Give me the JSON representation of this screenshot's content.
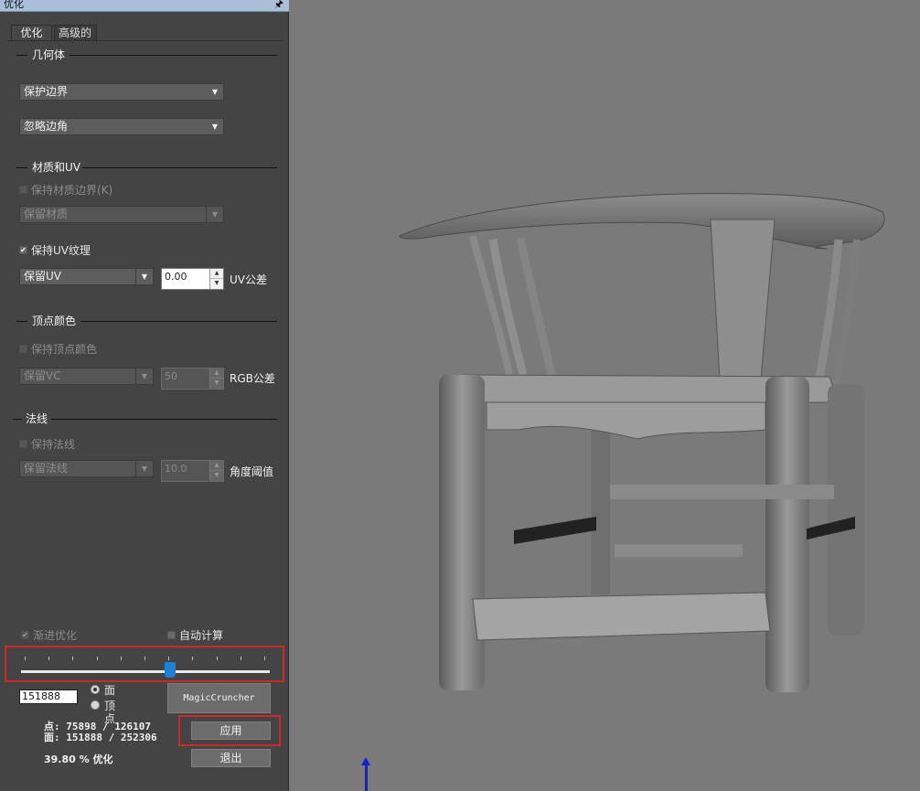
{
  "window": {
    "title": "优化",
    "pin_icon": "pin-icon"
  },
  "tabs": [
    {
      "label": "优化",
      "active": true
    },
    {
      "label": "高级的",
      "active": false
    }
  ],
  "geometry": {
    "section_label": "几何体",
    "boundary_combo": "保护边界",
    "corner_combo": "忽略边角"
  },
  "material": {
    "section_label": "材质和UV",
    "keep_material_boundary": {
      "label": "保持材质边界(K)",
      "checked": false,
      "enabled": false
    },
    "material_combo": "保留材质",
    "keep_uv_texture": {
      "label": "保持UV纹理",
      "checked": true,
      "enabled": true
    },
    "uv_combo": "保留UV",
    "uv_tolerance_value": "0.00",
    "uv_tolerance_label": "UV公差"
  },
  "vertex_color": {
    "section_label": "顶点颜色",
    "keep_vertex_color": {
      "label": "保持顶点颜色",
      "checked": false,
      "enabled": false
    },
    "vc_combo": "保留VC",
    "rgb_tolerance_value": "50",
    "rgb_tolerance_label": "RGB公差"
  },
  "normals": {
    "section_label": "法线",
    "keep_normals": {
      "label": "保持法线",
      "checked": false,
      "enabled": false
    },
    "normal_combo": "保留法线",
    "angle_value": "10.0",
    "angle_label": "角度阈值"
  },
  "bottom": {
    "progressive": {
      "label": "渐进优化",
      "checked": true,
      "enabled": false
    },
    "auto_compute": {
      "label": "自动计算",
      "checked": false
    },
    "slider_fraction": 0.6,
    "count_value": "151888",
    "radio_faces": "面",
    "radio_vertices": "顶点",
    "radio_selected": "faces",
    "magic_button": "MagicCruncher",
    "apply_button": "应用",
    "exit_button": "退出",
    "stats_points": "点: 75898 / 126107",
    "stats_faces": "面: 151888 / 252306",
    "optimize_percent": "39.80 % 优化"
  },
  "colors": {
    "panel_bg": "#444444",
    "viewport_bg": "#7a7a7a",
    "highlight_red": "#cc2a2a",
    "slider_handle": "#1e7fd6",
    "axis_blue": "#1020d8"
  }
}
